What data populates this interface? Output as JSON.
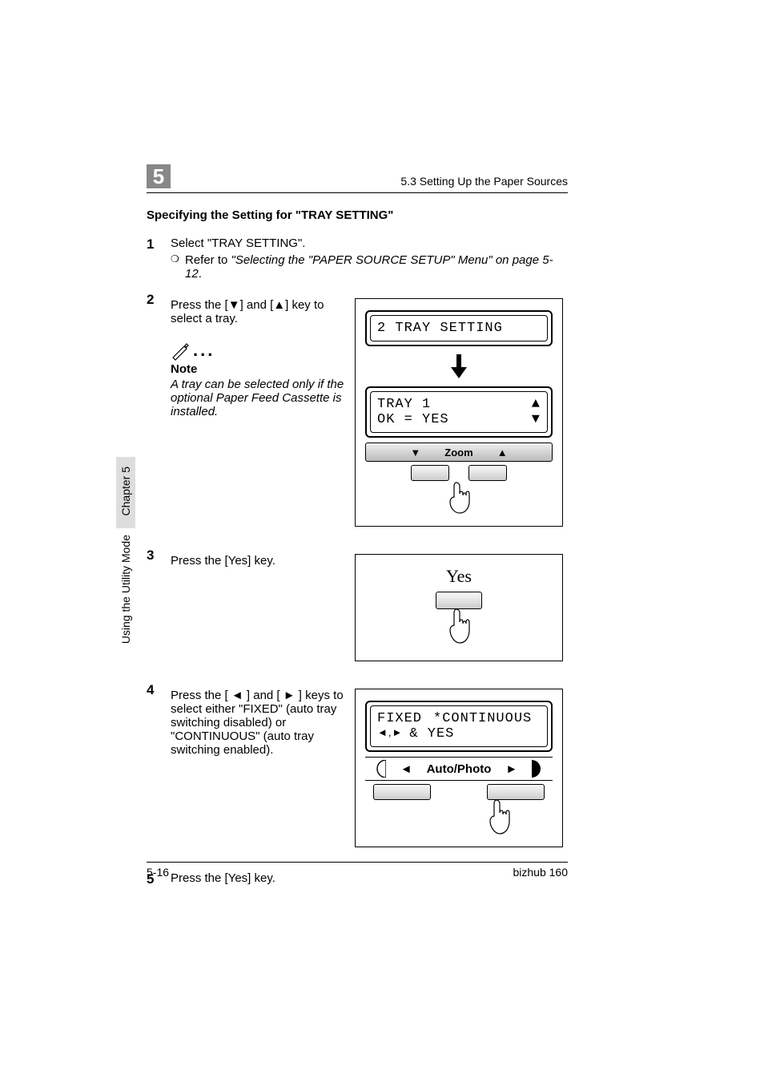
{
  "header": {
    "chapter_number": "5",
    "section_label": "5.3 Setting Up the Paper Sources"
  },
  "side": {
    "chapter_label": "Chapter 5",
    "mode_label": "Using the Utility Mode"
  },
  "heading": "Specifying the Setting for \"TRAY SETTING\"",
  "steps": {
    "s1": {
      "num": "1",
      "text": "Select \"TRAY SETTING\".",
      "ref_prefix": "Refer to ",
      "ref_italic": "\"Selecting the \"PAPER SOURCE SETUP\" Menu\" on page 5-12",
      "ref_suffix": "."
    },
    "s2": {
      "num": "2",
      "text_a": "Press the [",
      "text_b": "] and [",
      "text_c": "] key to select a tray.",
      "note_heading": "Note",
      "note_text": "A tray can be selected only if the optional Paper Feed Cassette is installed."
    },
    "s3": {
      "num": "3",
      "text": "Press the [Yes] key."
    },
    "s4": {
      "num": "4",
      "text_a": "Press the [ ",
      "text_b": " ] and [ ",
      "text_c": " ] keys to select either \"FIXED\" (auto tray switching disabled) or \"CONTINUOUS\" (auto tray switching enabled)."
    },
    "s5": {
      "num": "5",
      "text": "Press the [Yes] key."
    }
  },
  "diagrams": {
    "d2": {
      "lcd1": "2 TRAY SETTING",
      "lcd2a": "TRAY 1",
      "lcd2b": "OK = YES",
      "zoom_label": "Zoom"
    },
    "d3": {
      "yes_label": "Yes"
    },
    "d4": {
      "lcd_line1_a": "FIXED",
      "lcd_line1_b": "*CONTINUOUS",
      "lcd_line2_a": "◄,►",
      "lcd_line2_b": "& YES",
      "auto_label": "Auto/Photo"
    }
  },
  "footer": {
    "page": "5-16",
    "model": "bizhub 160"
  },
  "icons": {
    "bullet": "❍",
    "down_tri": "▼",
    "up_tri": "▲",
    "left_tri": "◄",
    "right_tri": "►"
  }
}
